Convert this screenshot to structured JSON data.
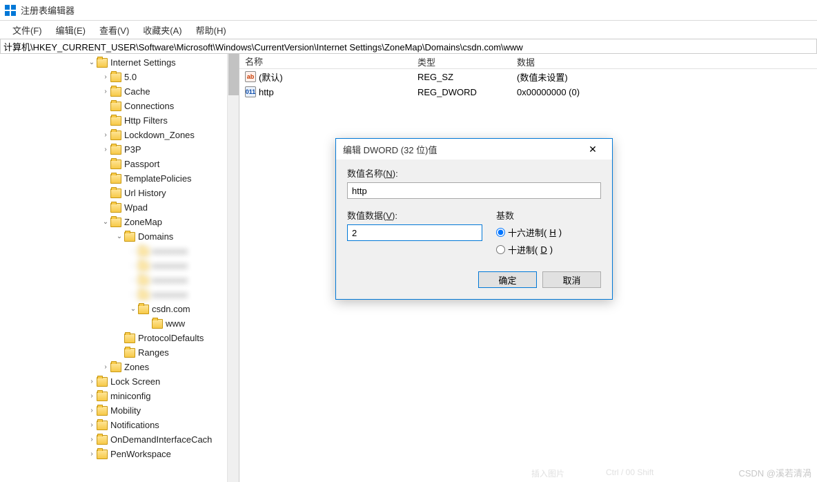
{
  "window": {
    "title": "注册表编辑器"
  },
  "menu": {
    "file": "文件(F)",
    "edit": "编辑(E)",
    "view": "查看(V)",
    "favorites": "收藏夹(A)",
    "help": "帮助(H)"
  },
  "path": "计算机\\HKEY_CURRENT_USER\\Software\\Microsoft\\Windows\\CurrentVersion\\Internet Settings\\ZoneMap\\Domains\\csdn.com\\www",
  "tree": {
    "internetSettings": "Internet Settings",
    "fiveO": "5.0",
    "cache": "Cache",
    "connections": "Connections",
    "httpFilters": "Http Filters",
    "lockdownZones": "Lockdown_Zones",
    "p3p": "P3P",
    "passport": "Passport",
    "templatePolicies": "TemplatePolicies",
    "urlHistory": "Url History",
    "wpad": "Wpad",
    "zoneMap": "ZoneMap",
    "domains": "Domains",
    "blur1": "xxxxxxxx",
    "blur2": "xxxxxxxx",
    "blur3": "xxxxxxxx",
    "blur4": "xxxxxxxx",
    "csdn": "csdn.com",
    "www": "www",
    "protocolDefaults": "ProtocolDefaults",
    "ranges": "Ranges",
    "zones": "Zones",
    "lockScreen": "Lock Screen",
    "miniconfig": "miniconfig",
    "mobility": "Mobility",
    "notifications": "Notifications",
    "onDemand": "OnDemandInterfaceCach",
    "penWorkspace": "PenWorkspace"
  },
  "list": {
    "headers": {
      "name": "名称",
      "type": "类型",
      "data": "数据"
    },
    "rows": [
      {
        "icon": "sz",
        "iconText": "ab",
        "name": "(默认)",
        "type": "REG_SZ",
        "data": "(数值未设置)"
      },
      {
        "icon": "dw",
        "iconText": "011",
        "name": "http",
        "type": "REG_DWORD",
        "data": "0x00000000 (0)"
      }
    ]
  },
  "dialog": {
    "title": "编辑 DWORD (32 位)值",
    "nameLabelPrefix": "数值名称(",
    "nameLabelKey": "N",
    "nameLabelSuffix": "):",
    "nameValue": "http",
    "dataLabelPrefix": "数值数据(",
    "dataLabelKey": "V",
    "dataLabelSuffix": "):",
    "dataValue": "2",
    "baseLabel": "基数",
    "hexPrefix": "十六进制(",
    "hexKey": "H",
    "hexSuffix": ")",
    "decPrefix": "十进制(",
    "decKey": "D",
    "decSuffix": ")",
    "ok": "确定",
    "cancel": "取消"
  },
  "watermark": "CSDN @溪若清渦",
  "bottom": {
    "a": "插入图片",
    "b": "Ctrl / 00  Shift"
  }
}
